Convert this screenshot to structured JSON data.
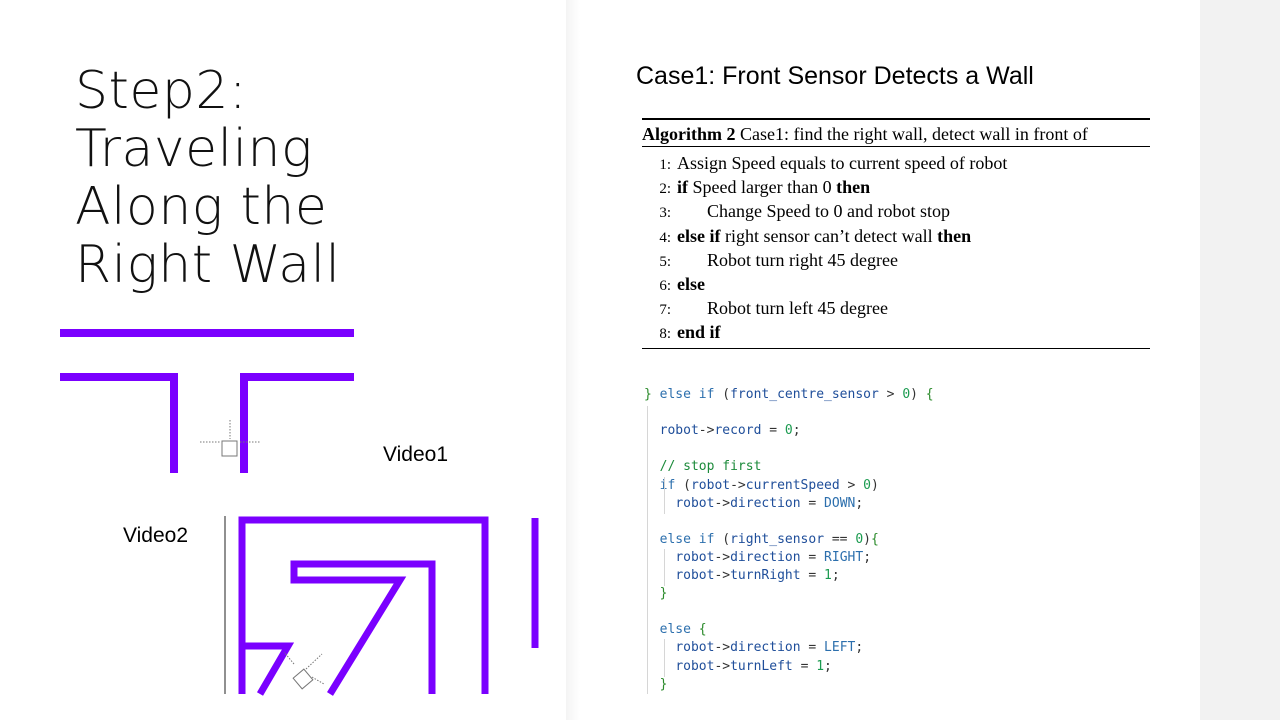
{
  "slide": {
    "title_lines": [
      "Step2:",
      "Traveling",
      "Along the",
      "Right Wall"
    ],
    "case_heading": "Case1: Front Sensor Detects a Wall",
    "video1_label": "Video1",
    "video2_label": "Video2"
  },
  "colors": {
    "wall": "#7a00ff",
    "background": "#ffffff",
    "side_strip": "#f2f2f2"
  },
  "algorithm": {
    "caption_bold": "Algorithm 2",
    "caption_text": " Case1: find the right wall, detect wall in front of",
    "lines": [
      {
        "num": "1:",
        "indent": 0,
        "kw1": "",
        "text": "Assign Speed equals to current speed of robot",
        "kw2": ""
      },
      {
        "num": "2:",
        "indent": 0,
        "kw1": "if",
        "text": " Speed larger than 0 ",
        "kw2": "then"
      },
      {
        "num": "3:",
        "indent": 1,
        "kw1": "",
        "text": "Change Speed to 0 and robot stop",
        "kw2": ""
      },
      {
        "num": "4:",
        "indent": 0,
        "kw1": "else if",
        "text": " right sensor can’t detect wall ",
        "kw2": "then"
      },
      {
        "num": "5:",
        "indent": 1,
        "kw1": "",
        "text": "Robot turn right 45 degree",
        "kw2": ""
      },
      {
        "num": "6:",
        "indent": 0,
        "kw1": "else",
        "text": "",
        "kw2": ""
      },
      {
        "num": "7:",
        "indent": 1,
        "kw1": "",
        "text": "Robot turn left 45 degree",
        "kw2": ""
      },
      {
        "num": "8:",
        "indent": 0,
        "kw1": "end if",
        "text": "",
        "kw2": ""
      }
    ]
  },
  "code": {
    "lines": [
      "} else if (front_centre_sensor > 0) {",
      "",
      "  robot->record = 0;",
      "",
      "  // stop first",
      "  if (robot->currentSpeed > 0)",
      "    robot->direction = DOWN;",
      "",
      "  else if (right_sensor == 0){",
      "    robot->direction = RIGHT;",
      "    robot->turnRight = 1;",
      "  }",
      "",
      "  else {",
      "    robot->direction = LEFT;",
      "    robot->turnLeft = 1;",
      "  }"
    ]
  }
}
